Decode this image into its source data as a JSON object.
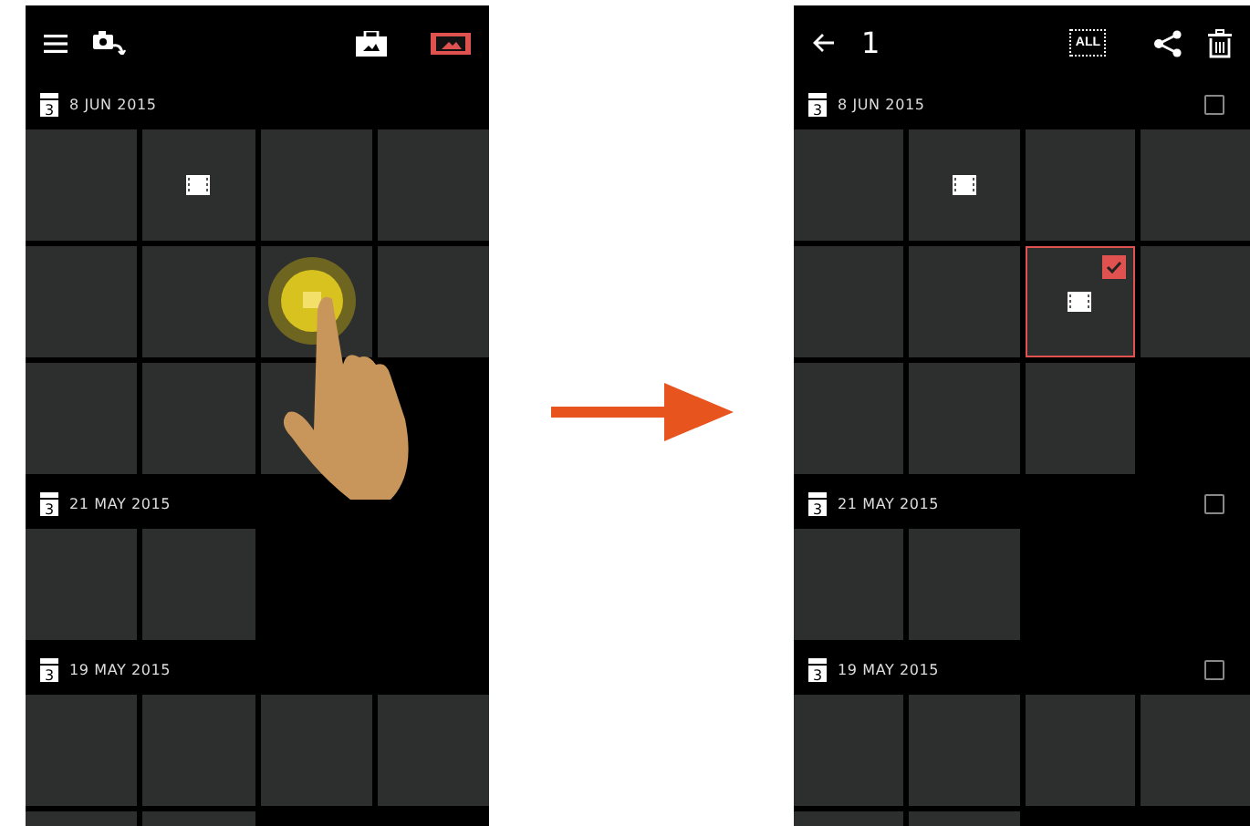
{
  "screens": [
    {
      "kind": "browse",
      "toolbar": {
        "view_toggles": [
          {
            "selected": false
          },
          {
            "selected": true
          }
        ]
      },
      "sections": [
        {
          "date": "8 JUN 2015",
          "calendar_digit": "3",
          "tiles": [
            {
              "kind": "photo",
              "pressed": false
            },
            {
              "kind": "video",
              "pressed": false
            },
            {
              "kind": "photo",
              "pressed": false
            },
            {
              "kind": "photo",
              "pressed": false
            },
            {
              "kind": "photo",
              "pressed": false
            },
            {
              "kind": "photo",
              "pressed": false
            },
            {
              "kind": "video",
              "pressed": true
            },
            {
              "kind": "photo",
              "pressed": false
            },
            {
              "kind": "photo",
              "pressed": false
            },
            {
              "kind": "photo",
              "pressed": false
            },
            {
              "kind": "photo",
              "pressed": false
            }
          ]
        },
        {
          "date": "21 MAY 2015",
          "calendar_digit": "3",
          "tiles": [
            {
              "kind": "photo",
              "pressed": false
            },
            {
              "kind": "photo",
              "pressed": false
            }
          ]
        },
        {
          "date": "19 MAY 2015",
          "calendar_digit": "3",
          "tiles": [
            {
              "kind": "photo",
              "pressed": false
            },
            {
              "kind": "photo",
              "pressed": false
            },
            {
              "kind": "photo",
              "pressed": false
            },
            {
              "kind": "photo",
              "pressed": false
            },
            {
              "kind": "photo",
              "pressed": false
            },
            {
              "kind": "photo",
              "pressed": false
            }
          ]
        }
      ]
    },
    {
      "kind": "select",
      "toolbar": {
        "count": "1",
        "select_all_label": "ALL"
      },
      "sections": [
        {
          "date": "8 JUN 2015",
          "calendar_digit": "3",
          "checked": false,
          "tiles": [
            {
              "kind": "photo",
              "selected": false
            },
            {
              "kind": "video",
              "selected": false
            },
            {
              "kind": "photo",
              "selected": false
            },
            {
              "kind": "photo",
              "selected": false
            },
            {
              "kind": "photo",
              "selected": false
            },
            {
              "kind": "photo",
              "selected": false
            },
            {
              "kind": "video",
              "selected": true
            },
            {
              "kind": "photo",
              "selected": false
            },
            {
              "kind": "photo",
              "selected": false
            },
            {
              "kind": "photo",
              "selected": false
            },
            {
              "kind": "photo",
              "selected": false
            }
          ]
        },
        {
          "date": "21 MAY 2015",
          "calendar_digit": "3",
          "checked": false,
          "tiles": [
            {
              "kind": "photo",
              "selected": false
            },
            {
              "kind": "photo",
              "selected": false
            }
          ]
        },
        {
          "date": "19 MAY 2015",
          "calendar_digit": "3",
          "checked": false,
          "tiles": [
            {
              "kind": "photo",
              "selected": false
            },
            {
              "kind": "photo",
              "selected": false
            },
            {
              "kind": "photo",
              "selected": false
            },
            {
              "kind": "photo",
              "selected": false
            },
            {
              "kind": "photo",
              "selected": false
            },
            {
              "kind": "photo",
              "selected": false
            }
          ]
        }
      ]
    }
  ]
}
